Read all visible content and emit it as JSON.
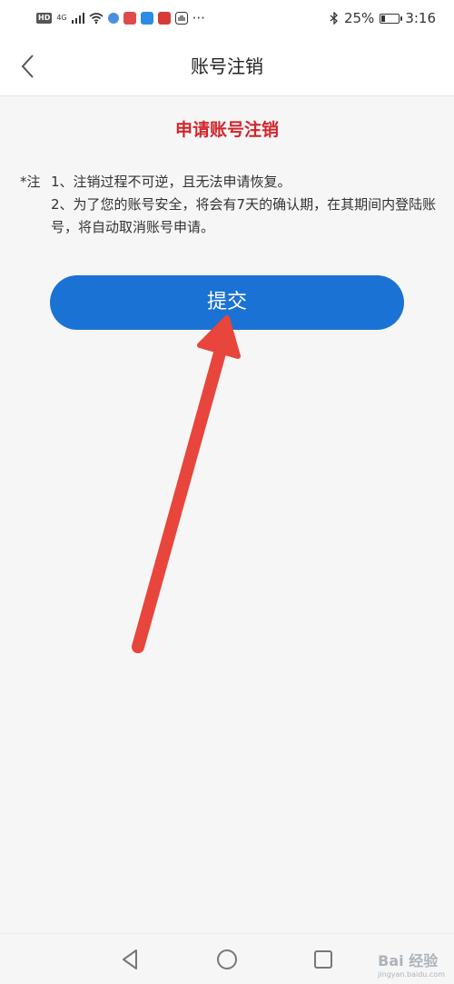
{
  "status_bar": {
    "hd": "HD",
    "network": "4G",
    "more": "···",
    "battery_percent": "25%",
    "time": "3:16",
    "battery_level": 0.25
  },
  "nav": {
    "title": "账号注销",
    "back_icon": "chevron-left-icon"
  },
  "content": {
    "title": "申请账号注销",
    "note_label": "*注",
    "notes": [
      "1、注销过程不可逆，且无法申请恢复。",
      "2、为了您的账号安全，将会有7天的确认期，在其期间内登陆账号，将自动取消账号申请。"
    ],
    "submit_label": "提交"
  },
  "annotation": {
    "arrow_color": "#e8453c"
  },
  "colors": {
    "title_red": "#d0262c",
    "button_blue": "#1a73d4"
  },
  "bottom_nav": {
    "back_icon": "triangle-back-icon",
    "home_icon": "circle-home-icon",
    "recents_icon": "square-recents-icon"
  },
  "watermark": {
    "brand": "Bai 经验",
    "url": "jingyan.baidu.com"
  }
}
